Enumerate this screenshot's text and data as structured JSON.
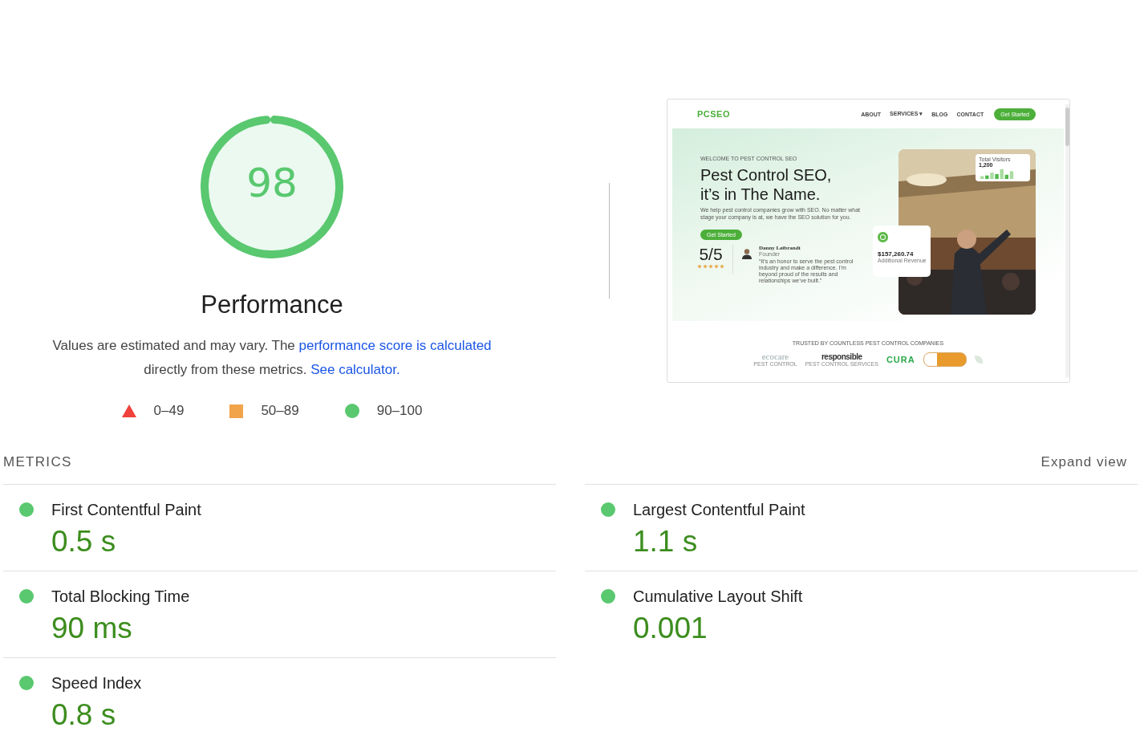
{
  "gauge": {
    "score": "98",
    "title": "Performance"
  },
  "description": {
    "text": "Values are estimated and may vary. The ",
    "link1": "performance score is calculated",
    "middle": " directly from these metrics. ",
    "link2": "See calculator."
  },
  "legend": [
    {
      "kind": "fail",
      "label": "0–49"
    },
    {
      "kind": "average",
      "label": "50–89"
    },
    {
      "kind": "pass",
      "label": "90–100"
    }
  ],
  "screenshot": {
    "nav": {
      "logo": "PCSEO",
      "links": [
        "ABOUT",
        "SERVICES ▾",
        "BLOG",
        "CONTACT"
      ],
      "cta": "Get Started"
    },
    "hero": {
      "eyebrow": "WELCOME TO PEST CONTROL SEO",
      "title_lines": [
        "Pest Control SEO,",
        "it’s in The Name."
      ],
      "text": "We help pest control companies grow with SEO. No matter what stage your company is at, we have the SEO solution for you.",
      "button": "Get Started",
      "rating": {
        "score": "5/5",
        "stars": 5
      },
      "testimonial": {
        "name": "Danny Leibrandt",
        "role": "Founder",
        "quote": "“It’s an honor to serve the pest control industry and make a difference. I’m beyond proud of the results and relationships we’ve built.”"
      },
      "stat": {
        "amount": "$157,260.74",
        "label": "Additional Revenue"
      },
      "visitors": {
        "title": "Total Visitors",
        "value": "1,200"
      }
    },
    "trusted": {
      "heading": "TRUSTED BY COUNTLESS PEST CONTROL COMPANIES",
      "logos": [
        {
          "text": "ecocare",
          "sub": "PEST CONTROL"
        },
        {
          "text": "responsible",
          "sub": "PEST CONTROL SERVICES"
        },
        {
          "text": "CURA"
        }
      ]
    }
  },
  "metrics_header": {
    "title": "METRICS",
    "toggle": "Expand view"
  },
  "metrics": [
    {
      "name": "First Contentful Paint",
      "value": "0.5 s"
    },
    {
      "name": "Largest Contentful Paint",
      "value": "1.1 s"
    },
    {
      "name": "Total Blocking Time",
      "value": "90 ms"
    },
    {
      "name": "Cumulative Layout Shift",
      "value": "0.001"
    },
    {
      "name": "Speed Index",
      "value": "0.8 s"
    }
  ]
}
